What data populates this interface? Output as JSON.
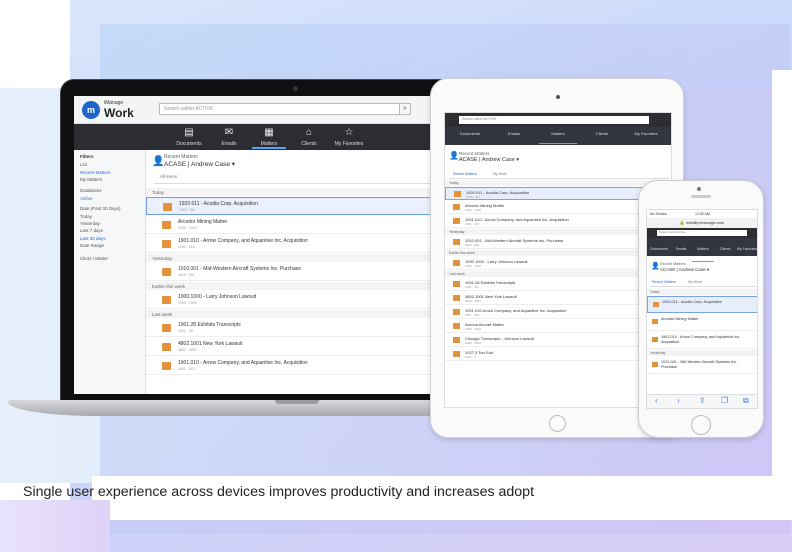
{
  "caption": "Single user experience across devices improves productivity and increases adopt",
  "colors": {
    "accent": "#1f64c8",
    "nav_dark": "#2c2c33",
    "doc_icon": "#e2923a",
    "selection": "#eaf1fc"
  },
  "laptop": {
    "logo_small": "iManage",
    "logo_big": "Work",
    "search_placeholder": "Search within ACTIVE",
    "nav": [
      {
        "icon": "documents-icon",
        "label": "Documents"
      },
      {
        "icon": "emails-icon",
        "label": "Emails"
      },
      {
        "icon": "matters-icon",
        "label": "Matters"
      },
      {
        "icon": "clients-icon",
        "label": "Clients"
      },
      {
        "icon": "favorites-icon",
        "label": "My Favorites"
      }
    ],
    "sidebar": [
      "Filters",
      "List",
      "Recent Matters",
      "My Matters",
      "Databases",
      "Active",
      "Date (Past 30 Days)",
      "Today",
      "Yesterday",
      "Last 7 days",
      "Last 30 days",
      "Date Range",
      "Client / Matter"
    ],
    "header_small": "Recent Matters",
    "header_big": "ACASE | Andrew Case ▾",
    "filter_label": "All items",
    "groups": [
      "Today",
      "Yesterday",
      "Earlier this week",
      "Last week"
    ],
    "rows": [
      {
        "title": "1920.011 - Acodia Corp. Acquisition",
        "sub": "1920 · 011"
      },
      {
        "title": "Arcodor Mining Matter",
        "sub": "0100 · 1010"
      },
      {
        "title": "1901.010 - Arrow Company, and Aquantive Inc. Acquisition",
        "sub": "1901 · 010"
      },
      {
        "title": "1010.001 - Mid-Western Aircraft Systems Inc. Purchase",
        "sub": "1010 · 001"
      },
      {
        "title": "1000.1000 - Larry Johnson Lawsuit",
        "sub": "1000 · 1000"
      },
      {
        "title": "1001.28 Exhibits Transcripts",
        "sub": "1001 · 28"
      },
      {
        "title": "4802.1001 New York Lawsuit",
        "sub": "4802 · 1001"
      },
      {
        "title": "1901.010 - Arrow Company, and Aquantive Inc. Acquisition",
        "sub": "1901 · 010"
      }
    ]
  },
  "tablet": {
    "search_placeholder": "Search within ACTIVE",
    "nav": [
      "Documents",
      "Emails",
      "Matters",
      "Clients",
      "My Favorites"
    ],
    "header_small": "Recent Matters",
    "header_big": "ACASE | Andrew Case ▾",
    "tabs": [
      "Recent Matters",
      "My Work"
    ],
    "groups": [
      "Today",
      "Yesterday",
      "Earlier this week",
      "Last week"
    ],
    "rows": [
      {
        "title": "1920.011 - Acodia Corp. Acquisition",
        "sub": "1920 · 011"
      },
      {
        "title": "Arcodor Mining Matter",
        "sub": "0100 · 1010"
      },
      {
        "title": "1901.010 - Arrow Company, and Aquantive Inc. Acquisition",
        "sub": "1901 · 010"
      },
      {
        "title": "1010.001 - Mid-Western Aircraft Systems Inc. Purchase",
        "sub": "1010 · 001"
      },
      {
        "title": "1000.1000 - Larry Johnson Lawsuit",
        "sub": "1000 · 1000"
      },
      {
        "title": "1001.28 Exhibits Transcripts",
        "sub": "1001 · 28"
      },
      {
        "title": "4802.1001 New York Lawsuit",
        "sub": "4802 · 1001"
      },
      {
        "title": "1901.010 Arrow Company, and Aquantive Inc. Acquisition",
        "sub": "1901 · 010"
      },
      {
        "title": "Aerona Aircraft Matter",
        "sub": "0100 · 1010"
      },
      {
        "title": "Chicago Transcripts - Johnson Lawsuit",
        "sub": "1000 · 1000"
      },
      {
        "title": "1027.3 Tort Suit",
        "sub": "1027 · 3"
      }
    ]
  },
  "phone": {
    "carrier": "No Service",
    "time": "12:00 AM",
    "url": "🔒 mobility.imanage.com",
    "search_placeholder": "Search within Active",
    "nav": [
      "Documents",
      "Emails",
      "Matters",
      "Clients",
      "My Favorites"
    ],
    "header_small": "Recent Matters",
    "header_big": "ACASE | Andrew Case ▾",
    "tabs": [
      "Recent Matters",
      "My Work"
    ],
    "groups": [
      "Today",
      "Yesterday"
    ],
    "rows": [
      {
        "title": "1920.011 - Acodia Corp. Acquisition"
      },
      {
        "title": "Arcodor Mining Matter"
      },
      {
        "title": "1901.010 - Arrow Company, and Aquantive Inc. Acquisition"
      },
      {
        "title": "1010.001 - Mid-Western Aircraft Systems Inc. Purchase"
      }
    ],
    "toolbar": [
      "‹",
      "›",
      "⇪",
      "❐",
      "⧉"
    ]
  }
}
